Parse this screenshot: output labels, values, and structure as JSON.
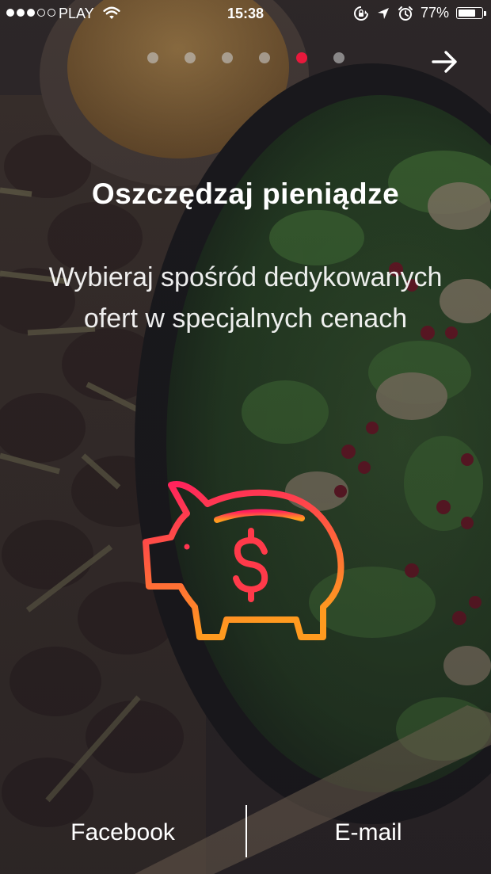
{
  "status_bar": {
    "carrier": "PLAY",
    "time": "15:38",
    "battery_percent": "77%",
    "battery_level": 0.77,
    "signal_strength": 3,
    "signal_max": 5
  },
  "pager": {
    "total": 6,
    "active_index": 4,
    "active_color": "#e8193c",
    "inactive_color": "#c8c8c8",
    "next_icon": "arrow-right-icon"
  },
  "onboarding": {
    "title": "Oszczędzaj pieniądze",
    "subtitle": "Wybieraj spośród dedykowanych ofert w specjalnych cenach",
    "icon": "piggy-bank-dollar-icon",
    "icon_gradient": [
      "#ff1f5e",
      "#ff9a1f"
    ]
  },
  "login": {
    "facebook_label": "Facebook",
    "email_label": "E-mail"
  }
}
